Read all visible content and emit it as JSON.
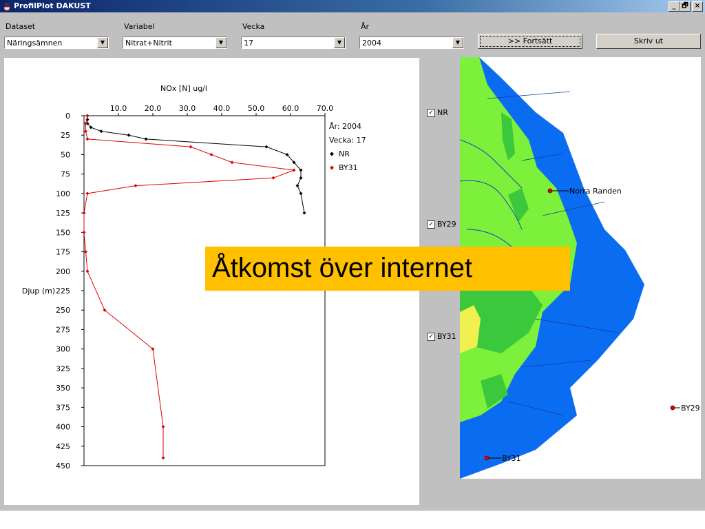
{
  "window": {
    "title": "ProfilPlot DAKUST",
    "controls": [
      "_",
      "🗗",
      "×"
    ]
  },
  "toolbar": {
    "dataset": {
      "label": "Dataset",
      "value": "Näringsämnen"
    },
    "variable": {
      "label": "Variabel",
      "value": "Nitrat+Nitrit"
    },
    "week": {
      "label": "Vecka",
      "value": "17"
    },
    "year": {
      "label": "År",
      "value": "2004"
    },
    "continue_label": ">> Fortsätt",
    "print_label": "Skriv ut"
  },
  "map": {
    "checkboxes": [
      {
        "label": "NR",
        "checked": true
      },
      {
        "label": "BY29",
        "checked": true
      },
      {
        "label": "BY31",
        "checked": true
      }
    ],
    "stations": [
      "Norra Randen",
      "BY29",
      "BY31"
    ],
    "colors": {
      "sea": "#0a6cf0",
      "land": "#7cf03a",
      "dark_land": "#3cc83c",
      "yellow": "#f0f050"
    }
  },
  "banner": {
    "text": "Åtkomst över internet",
    "color": "#ffc000"
  },
  "chart_data": {
    "type": "line",
    "title": "NOx [N] ug/l",
    "xlabel": "NOx [N] ug/l",
    "ylabel": "Djup (m)",
    "xlim": [
      0,
      70
    ],
    "ylim": [
      450,
      0
    ],
    "x_ticks": [
      "10.0",
      "20.0",
      "30.0",
      "40.0",
      "50.0",
      "60.0",
      "70.0"
    ],
    "y_ticks": [
      "0",
      "25",
      "50",
      "75",
      "100",
      "125",
      "150",
      "175",
      "200",
      "225",
      "250",
      "275",
      "300",
      "325",
      "350",
      "375",
      "400",
      "425",
      "450"
    ],
    "legend": {
      "placement": "right",
      "year_text": "År: 2004",
      "week_text": "Vecka: 17"
    },
    "series": [
      {
        "name": "NR",
        "color": "#000000",
        "points": [
          [
            1,
            0
          ],
          [
            1,
            5
          ],
          [
            1,
            10
          ],
          [
            2,
            15
          ],
          [
            5,
            20
          ],
          [
            13,
            25
          ],
          [
            18,
            30
          ],
          [
            53,
            40
          ],
          [
            59,
            50
          ],
          [
            61,
            60
          ],
          [
            63,
            70
          ],
          [
            63,
            80
          ],
          [
            62,
            90
          ],
          [
            63,
            100
          ],
          [
            64,
            125
          ]
        ]
      },
      {
        "name": "BY31",
        "color": "#e00000",
        "points": [
          [
            1,
            0
          ],
          [
            0.5,
            10
          ],
          [
            0.5,
            20
          ],
          [
            1,
            30
          ],
          [
            31,
            40
          ],
          [
            37,
            50
          ],
          [
            43,
            60
          ],
          [
            61,
            70
          ],
          [
            55,
            80
          ],
          [
            15,
            90
          ],
          [
            1,
            100
          ],
          [
            0,
            125
          ],
          [
            0,
            150
          ],
          [
            0.5,
            175
          ],
          [
            1,
            200
          ],
          [
            6,
            250
          ],
          [
            20,
            300
          ],
          [
            23,
            400
          ],
          [
            23,
            440
          ]
        ]
      }
    ]
  }
}
